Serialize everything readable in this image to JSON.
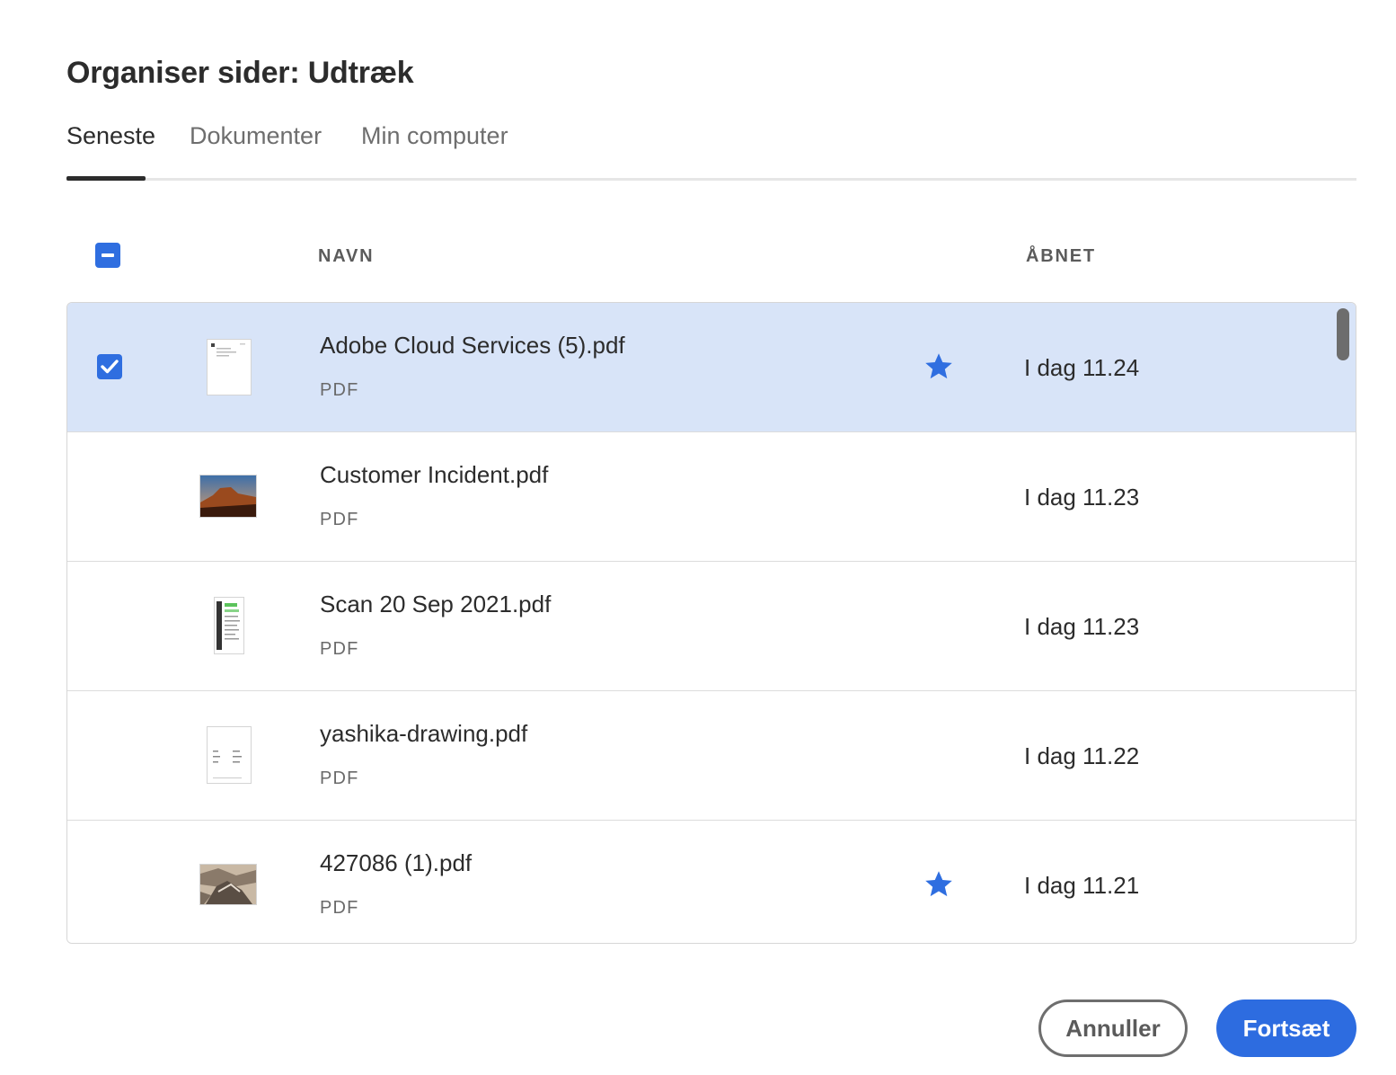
{
  "dialog": {
    "title": "Organiser sider: Udtræk"
  },
  "tabs": [
    {
      "label": "Seneste",
      "active": true
    },
    {
      "label": "Dokumenter",
      "active": false
    },
    {
      "label": "Min computer",
      "active": false
    }
  ],
  "table": {
    "select_all_state": "indeterminate",
    "columns": {
      "name": "NAVN",
      "opened": "ÅBNET"
    },
    "rows": [
      {
        "name": "Adobe Cloud Services (5).pdf",
        "type": "PDF",
        "opened": "I dag 11.24",
        "starred": true,
        "selected": true,
        "thumbnail": "document-page"
      },
      {
        "name": "Customer Incident.pdf",
        "type": "PDF",
        "opened": "I dag 11.23",
        "starred": false,
        "selected": false,
        "thumbnail": "landscape-photo"
      },
      {
        "name": "Scan 20 Sep 2021.pdf",
        "type": "PDF",
        "opened": "I dag 11.23",
        "starred": false,
        "selected": false,
        "thumbnail": "scanned-page"
      },
      {
        "name": "yashika-drawing.pdf",
        "type": "PDF",
        "opened": "I dag 11.22",
        "starred": false,
        "selected": false,
        "thumbnail": "drawing-page"
      },
      {
        "name": "427086 (1).pdf",
        "type": "PDF",
        "opened": "I dag 11.21",
        "starred": true,
        "selected": false,
        "thumbnail": "rock-photo"
      }
    ]
  },
  "footer": {
    "cancel_label": "Annuller",
    "continue_label": "Fortsæt"
  },
  "colors": {
    "accent": "#2f6ee0",
    "selected_row": "#d8e4f8",
    "star": "#2f6ee0"
  }
}
